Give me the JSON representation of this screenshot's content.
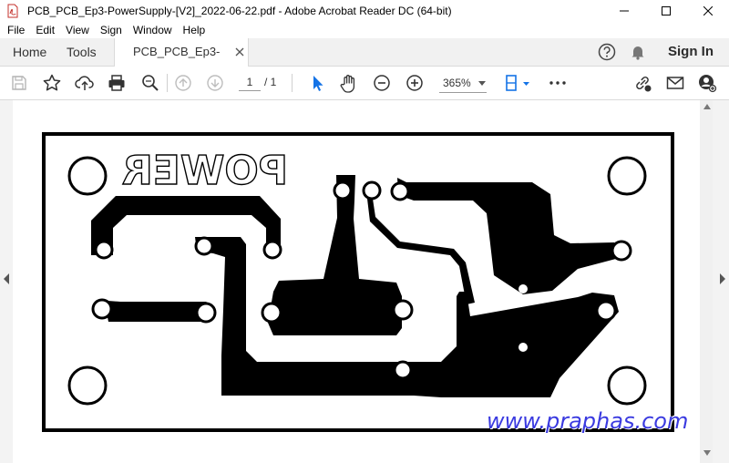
{
  "window": {
    "title": "PCB_PCB_Ep3-PowerSupply-[V2]_2022-06-22.pdf - Adobe Acrobat Reader DC (64-bit)",
    "icon": "acrobat-pdf-icon",
    "controls": [
      "minimize-icon",
      "maximize-icon",
      "close-icon"
    ]
  },
  "menu": {
    "items": [
      "File",
      "Edit",
      "View",
      "Sign",
      "Window",
      "Help"
    ]
  },
  "tabs": {
    "home": "Home",
    "tools": "Tools",
    "document": "PCB_PCB_Ep3-Pow...",
    "sign_in": "Sign In"
  },
  "toolbar": {
    "current_page": "1",
    "page_separator": "/ 1",
    "zoom": "365%",
    "icons": [
      "save-icon",
      "bookmark-star-icon",
      "upload-cloud-icon",
      "print-icon",
      "find-icon",
      "page-up-icon",
      "page-down-icon",
      "select-cursor-icon",
      "hand-icon",
      "zoom-out-icon",
      "zoom-in-icon",
      "fit-page-icon",
      "more-icon",
      "share-link-icon",
      "email-icon",
      "account-icon"
    ]
  },
  "document": {
    "silkscreen_label": "POWER",
    "watermark": "www.praphas.com"
  },
  "colors": {
    "copper": "#000000",
    "accent": "#1473e6",
    "watermark": "#3a3ae0"
  }
}
